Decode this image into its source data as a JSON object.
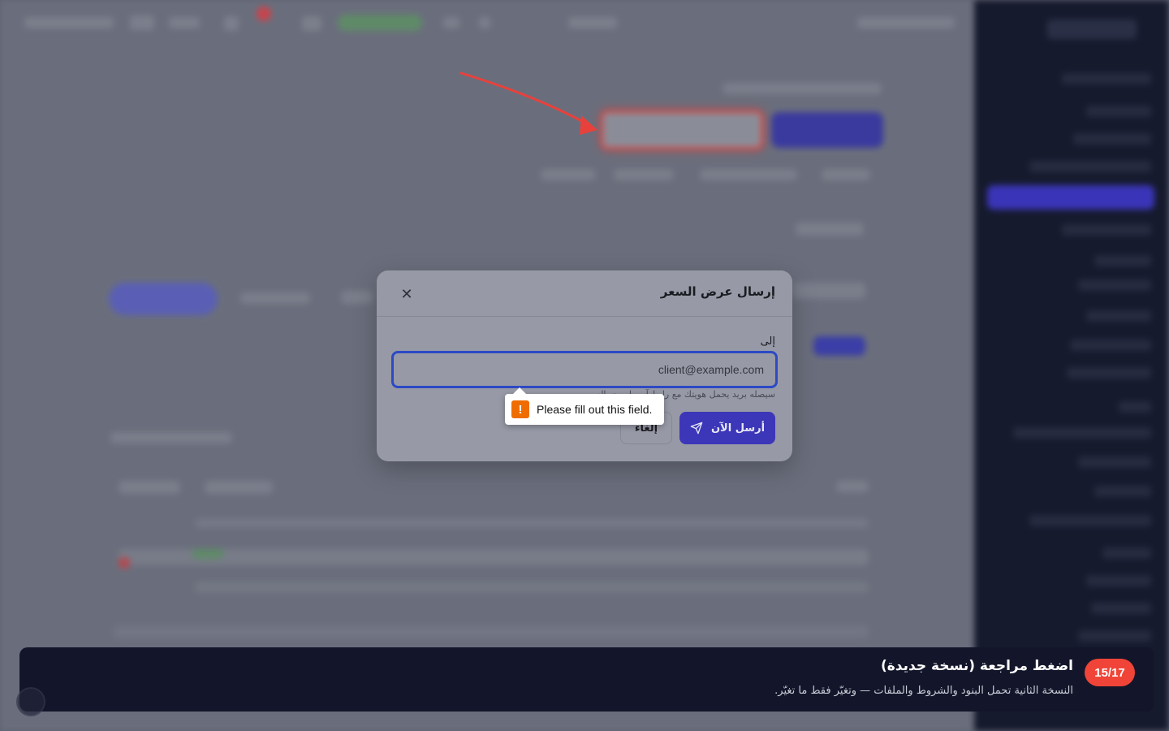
{
  "modal": {
    "title": "إرسال عرض السعر",
    "close_icon": "close-icon",
    "to_label": "إلى",
    "email_placeholder": "client@example.com",
    "hint": "سيصله بريد يحمل هويتك مع رابط آمن لعرض السعر.",
    "send_label": "أرسل الآن",
    "send_icon": "paper-plane-icon",
    "cancel_label": "إلغاء"
  },
  "validation": {
    "message": "Please fill out this field.",
    "icon": "warning-icon",
    "icon_glyph": "!"
  },
  "tour": {
    "step": "15/17",
    "title": "اضغط مراجعة (نسخة جديدة)",
    "description": "النسخة الثانية تحمل البنود والشروط والملفات — وتغيّر فقط ما تغيّر."
  },
  "colors": {
    "accent": "#3c36b8",
    "highlight": "#e0423e",
    "tour_badge": "#f04438",
    "warning": "#ef6c00"
  }
}
